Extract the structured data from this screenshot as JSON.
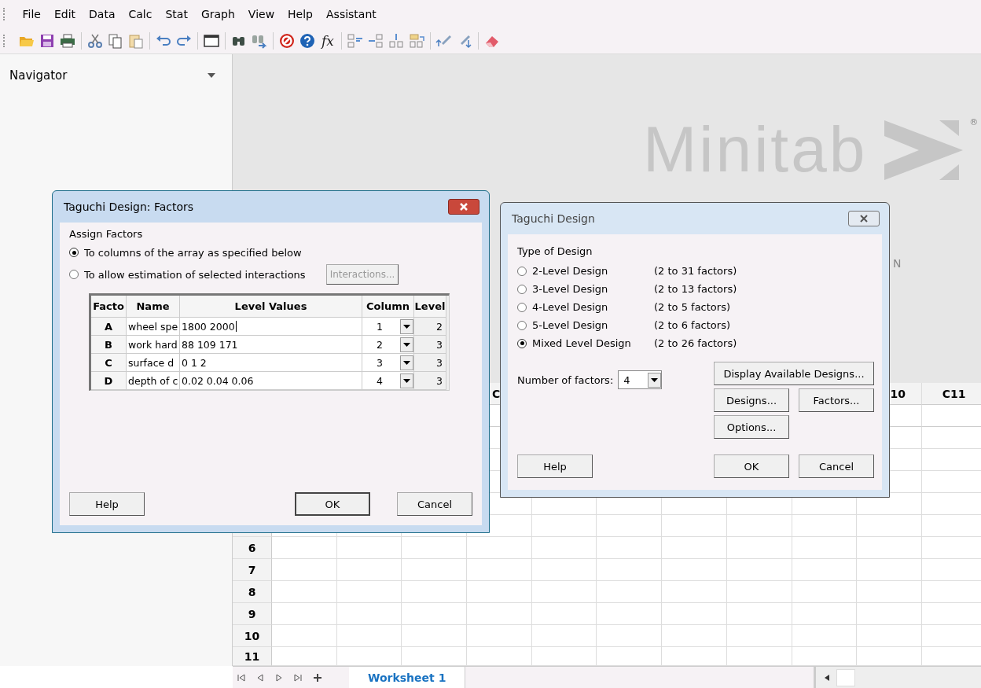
{
  "menu": [
    {
      "label": "File"
    },
    {
      "label": "Edit"
    },
    {
      "label": "Data"
    },
    {
      "label": "Calc"
    },
    {
      "label": "Stat"
    },
    {
      "label": "Graph"
    },
    {
      "label": "View"
    },
    {
      "label": "Help"
    },
    {
      "label": "Assistant"
    }
  ],
  "toolbar": {
    "formula_button": "fx"
  },
  "navigator": {
    "title": "Navigator"
  },
  "welcome": {
    "logo_text": "Minitab",
    "registered_mark": "®",
    "partial_text": "N"
  },
  "worksheet": {
    "column_headers": [
      "C",
      "10",
      "C11"
    ],
    "row_numbers": [
      "6",
      "7",
      "8",
      "9",
      "10",
      "11"
    ],
    "tab": "Worksheet 1"
  },
  "factors_dialog": {
    "title": "Taguchi Design: Factors",
    "section": "Assign Factors",
    "options": [
      {
        "label": "To columns of the array as specified below",
        "selected": true
      },
      {
        "label": "To allow estimation of selected interactions",
        "selected": false
      }
    ],
    "interactions_button": {
      "label": "Interactions...",
      "disabled": true
    },
    "table": {
      "columns": [
        "Facto",
        "Name",
        "Level Values",
        "Column",
        "Level"
      ],
      "rows": [
        {
          "factor": "A",
          "name": "wheel spe",
          "level_values": "1800 2000",
          "column": "1",
          "levels": "2",
          "editing": true
        },
        {
          "factor": "B",
          "name": "work hard",
          "level_values": "88 109 171",
          "column": "2",
          "levels": "3",
          "editing": false
        },
        {
          "factor": "C",
          "name": "surface d",
          "level_values": "0 1 2",
          "column": "3",
          "levels": "3",
          "editing": false
        },
        {
          "factor": "D",
          "name": "depth of c",
          "level_values": "0.02 0.04 0.06",
          "column": "4",
          "levels": "3",
          "editing": false
        }
      ]
    },
    "buttons": [
      {
        "label": "Help",
        "kind": "help"
      },
      {
        "label": "OK",
        "kind": "ok"
      },
      {
        "label": "Cancel",
        "kind": "cancel"
      }
    ]
  },
  "design_dialog": {
    "title": "Taguchi Design",
    "section": "Type of Design",
    "designs": [
      {
        "label": "2-Level Design",
        "range": "(2 to 31 factors)",
        "selected": false
      },
      {
        "label": "3-Level Design",
        "range": "(2 to 13 factors)",
        "selected": false
      },
      {
        "label": "4-Level Design",
        "range": "(2 to 5 factors)",
        "selected": false
      },
      {
        "label": "5-Level Design",
        "range": "(2 to 6 factors)",
        "selected": false
      },
      {
        "label": "Mixed Level Design",
        "range": "(2 to 26 factors)",
        "selected": true
      }
    ],
    "number_of_factors": {
      "label": "Number of factors:",
      "value": "4"
    },
    "display_button": "Display Available Designs...",
    "designs_button": "Designs...",
    "factors_button": "Factors...",
    "options_button": "Options...",
    "help_button": "Help",
    "ok_button": "OK",
    "cancel_button": "Cancel"
  }
}
